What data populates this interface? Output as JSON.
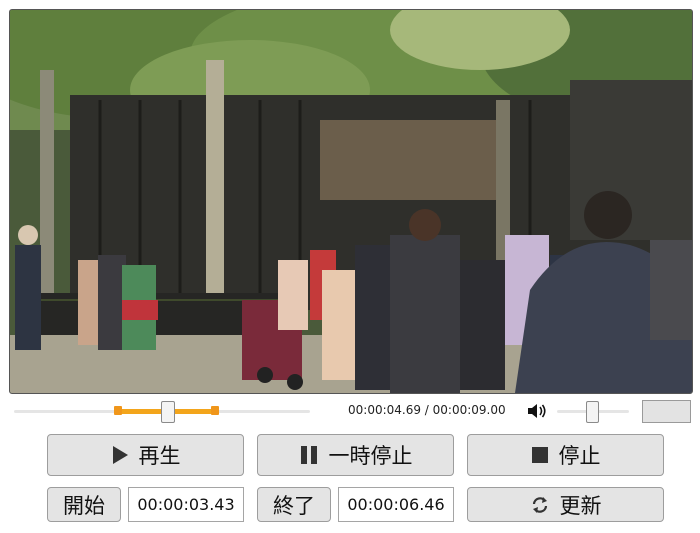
{
  "player": {
    "time_readout": "00:00:04.69 / 00:00:09.00",
    "position_fraction": 0.521,
    "range_start_fraction": 0.381,
    "range_end_fraction": 0.718,
    "volume_fraction": 0.5
  },
  "controls": {
    "play_label": "再生",
    "pause_label": "一時停止",
    "stop_label": "停止",
    "start_label": "開始",
    "start_time": "00:00:03.43",
    "end_label": "終了",
    "end_time": "00:00:06.46",
    "update_label": "更新"
  },
  "icons": {
    "play": "play-icon",
    "pause": "pause-icon",
    "stop": "stop-icon",
    "update": "refresh-icon",
    "volume": "speaker-icon"
  },
  "colors": {
    "range_accent": "#f3a51b"
  }
}
